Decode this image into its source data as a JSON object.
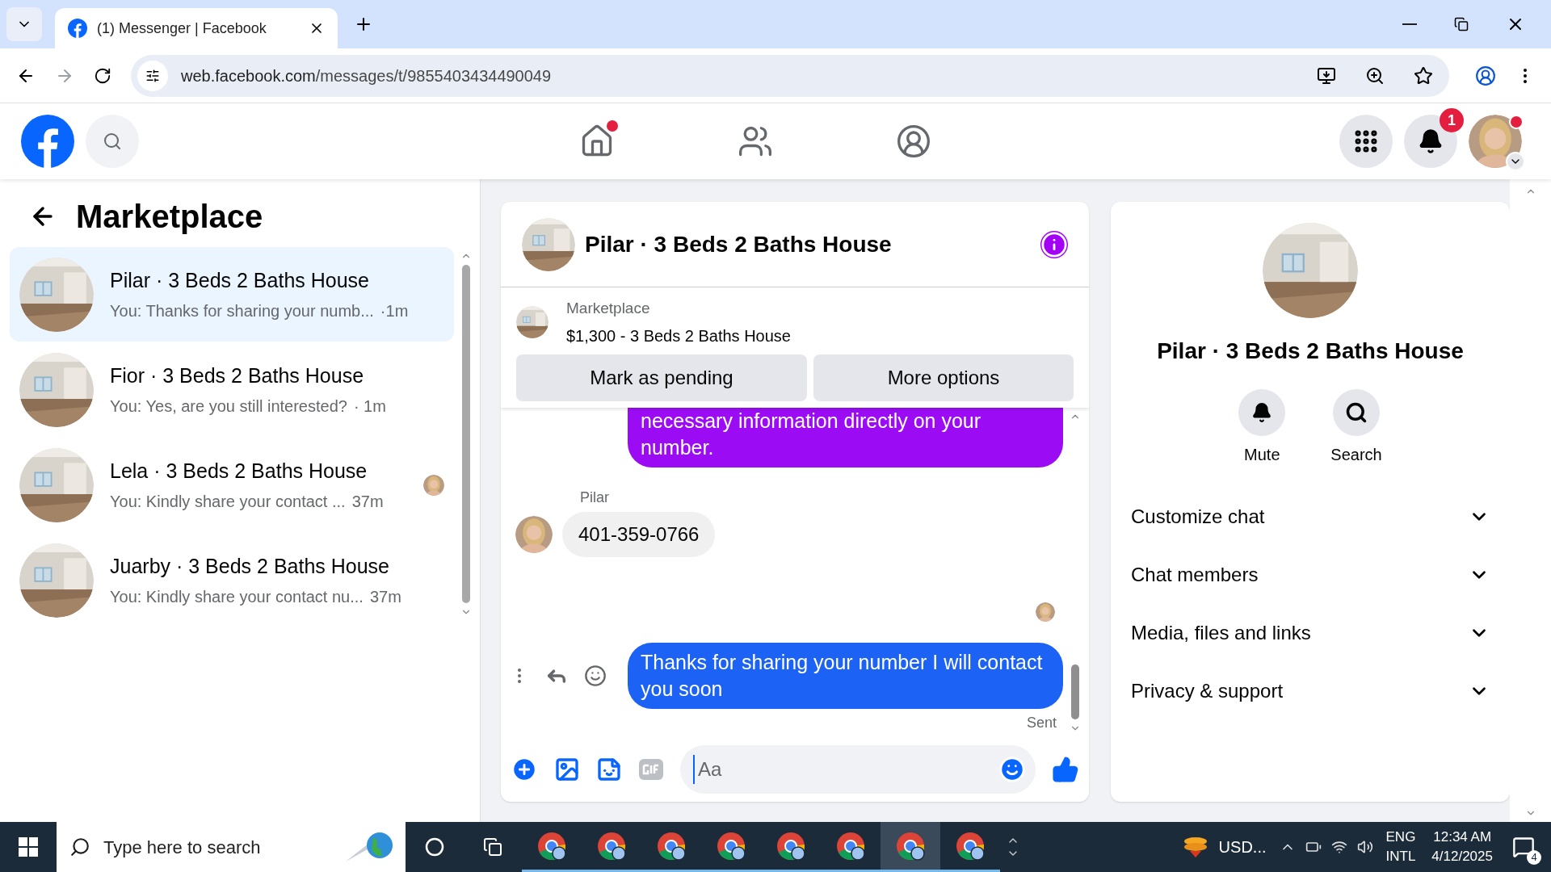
{
  "browser": {
    "tabs": [
      {
        "title": "(1) Messenger | Facebook",
        "selected": true
      }
    ],
    "url_host": "web.facebook.com",
    "url_path": "/messages/t/9855403434490049"
  },
  "header": {
    "notifications_badge": "1"
  },
  "sidebar": {
    "title": "Marketplace",
    "conversations": [
      {
        "name": "Pilar · 3 Beds 2 Baths House",
        "preview": "You: Thanks for sharing your numb...",
        "time": "·1m",
        "selected": true,
        "seen_avatar": false
      },
      {
        "name": "Fior · 3 Beds 2 Baths House",
        "preview": "You: Yes, are you still interested?",
        "time": "· 1m",
        "selected": false,
        "seen_avatar": false
      },
      {
        "name": "Lela · 3 Beds 2 Baths House",
        "preview": "You: Kindly share your contact ...",
        "time": "37m",
        "selected": false,
        "seen_avatar": true
      },
      {
        "name": "Juarby · 3 Beds 2 Baths House",
        "preview": "You: Kindly share your contact nu...",
        "time": "37m",
        "selected": false,
        "seen_avatar": false
      }
    ]
  },
  "chat": {
    "title": "Pilar · 3 Beds 2 Baths House",
    "listing": {
      "label": "Marketplace",
      "title": "$1,300 - 3 Beds 2 Baths House"
    },
    "buttons": [
      "Mark as pending",
      "More options"
    ],
    "messages": [
      {
        "kind": "outgoing",
        "text": "necessary information directly on your number.",
        "color": "#9b0cf5"
      },
      {
        "kind": "incoming",
        "sender": "Pilar",
        "text": "401-359-0766"
      },
      {
        "kind": "outgoing",
        "text": "Thanks for sharing your number I will contact you soon",
        "color": "#1b62f5",
        "status": "Sent"
      }
    ],
    "composer": {
      "placeholder": "Aa"
    }
  },
  "info": {
    "name": "Pilar · 3 Beds 2 Baths House",
    "actions": [
      "Mute",
      "Search"
    ],
    "sections": [
      {
        "label": "Customize chat",
        "expanded": false
      },
      {
        "label": "Chat members",
        "expanded": false
      },
      {
        "label": "Media, files and links",
        "expanded": false
      },
      {
        "label": "Privacy & support",
        "expanded": false
      }
    ]
  },
  "taskbar": {
    "search_placeholder": "Type here to search",
    "apps": [
      {
        "selected": false
      },
      {
        "selected": false
      },
      {
        "selected": false
      },
      {
        "selected": false
      },
      {
        "selected": false
      },
      {
        "selected": false
      },
      {
        "selected": true
      },
      {
        "selected": false
      }
    ],
    "widget": "USD...",
    "language": "ENG",
    "layout": "INTL",
    "time": "12:34 AM",
    "date": "4/12/2025",
    "notification_count": "4"
  }
}
